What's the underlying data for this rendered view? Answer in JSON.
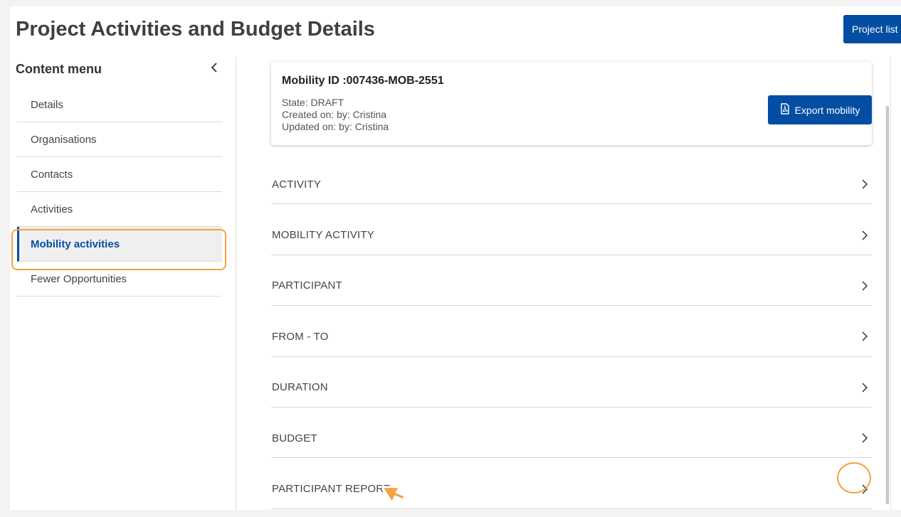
{
  "header": {
    "title": "Project Activities and Budget Details",
    "project_list_label": "Project list"
  },
  "sidebar": {
    "title": "Content menu",
    "items": [
      {
        "label": "Details",
        "active": false
      },
      {
        "label": "Organisations",
        "active": false
      },
      {
        "label": "Contacts",
        "active": false
      },
      {
        "label": "Activities",
        "active": false
      },
      {
        "label": "Mobility activities",
        "active": true
      },
      {
        "label": "Fewer Opportunities",
        "active": false
      }
    ]
  },
  "mobility": {
    "id_label": "Mobility ID :007436-MOB-2551",
    "state": "State: DRAFT",
    "created": "Created on: by: Cristina",
    "updated": "Updated on: by: Cristina",
    "export_label": "Export mobility"
  },
  "sections": [
    {
      "label": "ACTIVITY"
    },
    {
      "label": "MOBILITY ACTIVITY"
    },
    {
      "label": "PARTICIPANT"
    },
    {
      "label": "FROM - TO"
    },
    {
      "label": "DURATION"
    },
    {
      "label": "BUDGET"
    },
    {
      "label": "PARTICIPANT REPORT"
    }
  ],
  "colors": {
    "primary": "#034ea2",
    "highlight": "#f5a142",
    "cursor": "#f5a142"
  },
  "icons": {
    "collapse": "chevron-left-icon",
    "section": "chevron-right-icon",
    "export": "pdf-icon",
    "cursor": "pointer-cursor-icon"
  }
}
